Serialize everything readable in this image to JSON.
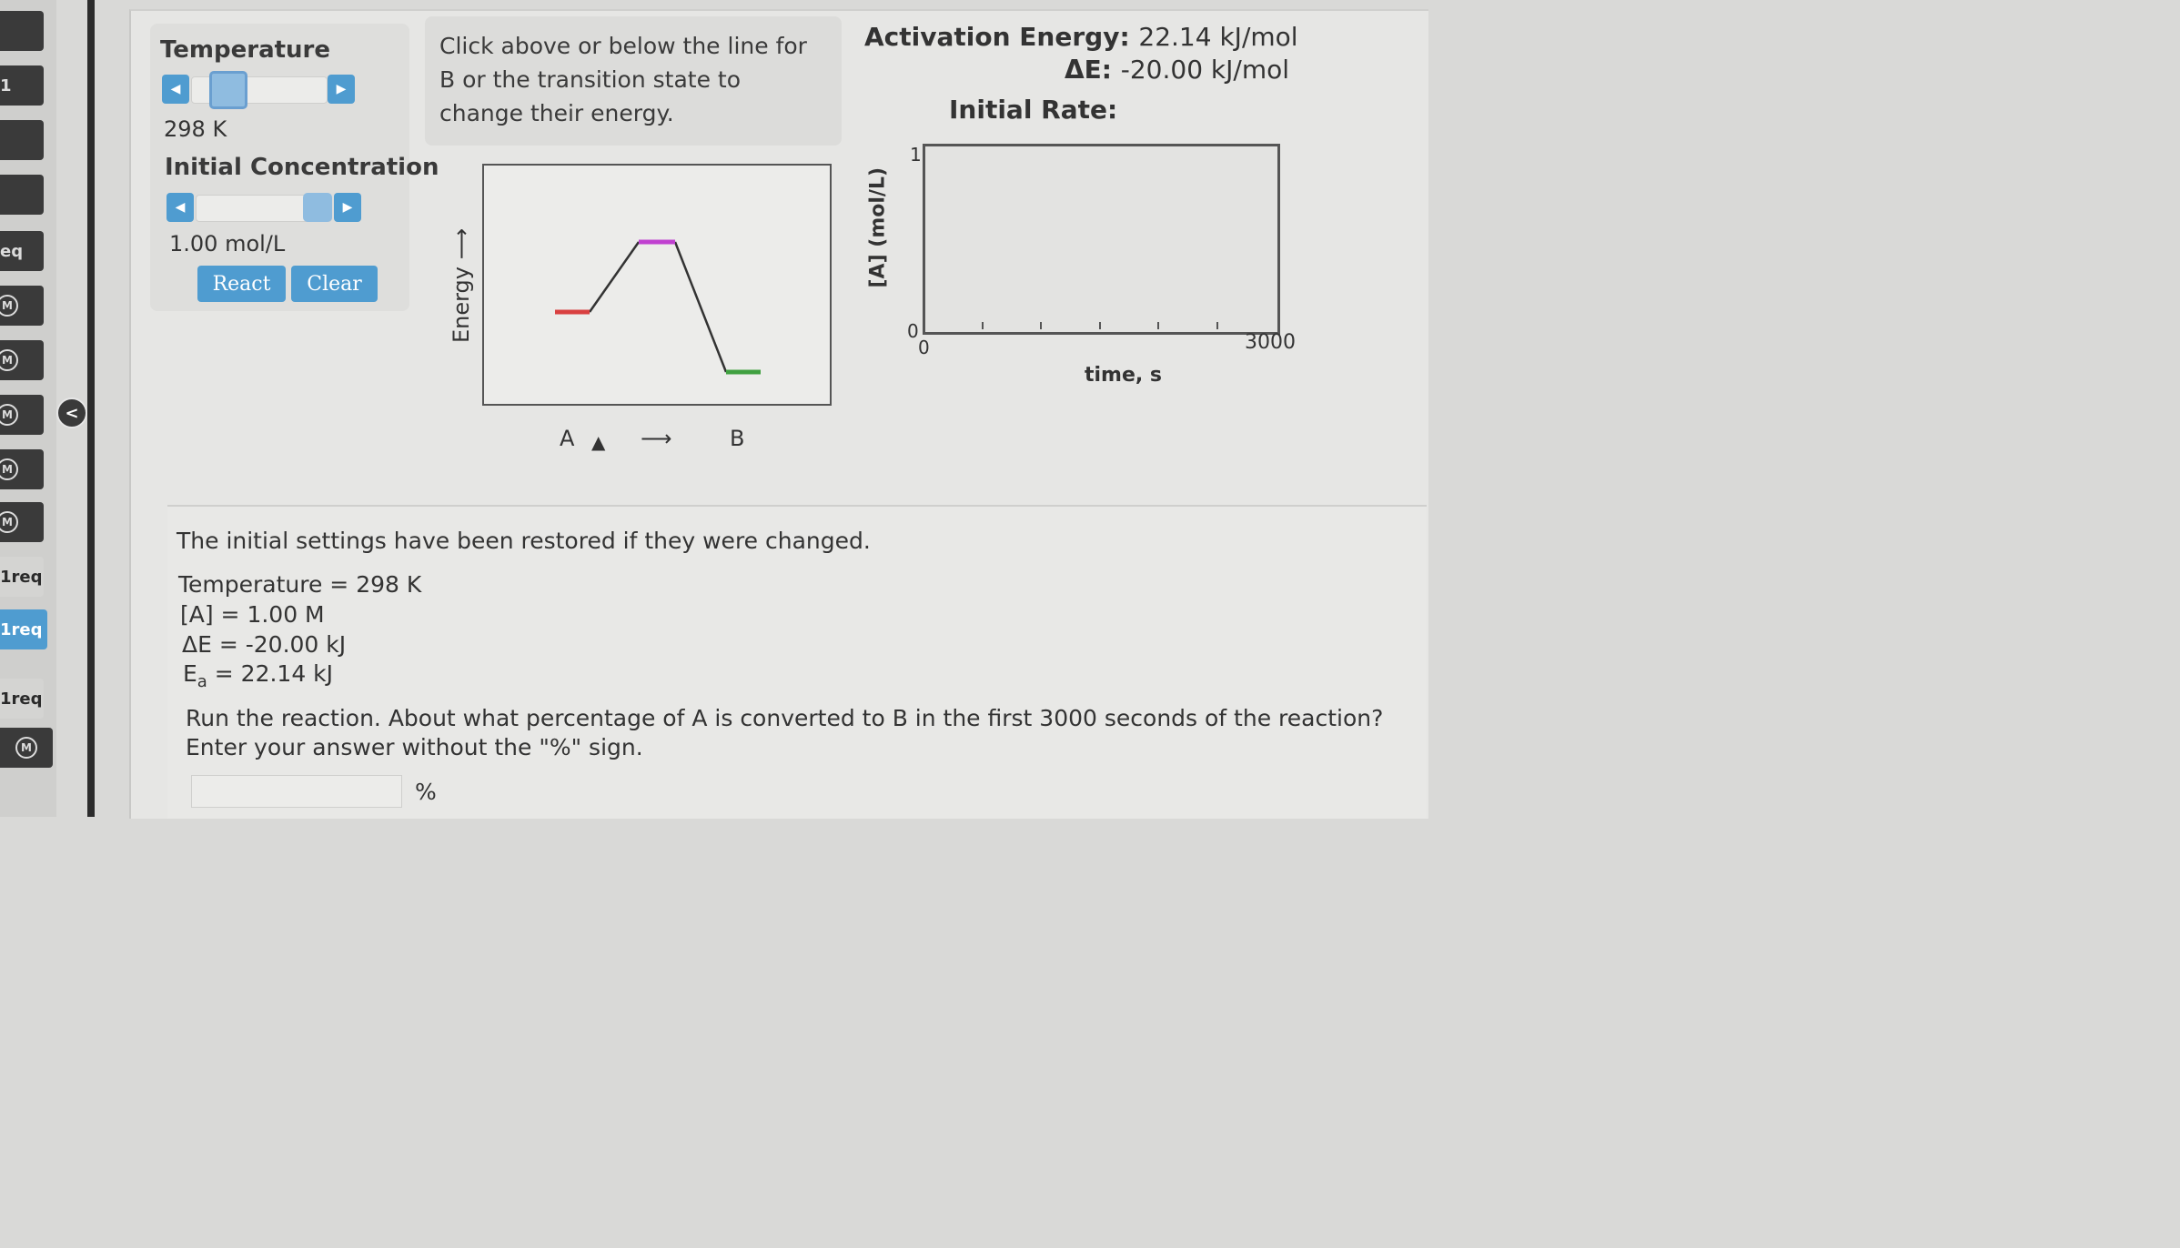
{
  "sidebar": {
    "items": [
      {
        "label": "",
        "style": "dark"
      },
      {
        "label": "1",
        "style": "dark"
      },
      {
        "label": "",
        "style": "dark"
      },
      {
        "label": "",
        "style": "dark"
      },
      {
        "label": "eq",
        "style": "dark"
      },
      {
        "label": "M",
        "style": "dark-m"
      },
      {
        "label": "M",
        "style": "dark-m"
      },
      {
        "label": "M",
        "style": "dark-m"
      },
      {
        "label": "M",
        "style": "dark-m"
      },
      {
        "label": "M",
        "style": "dark-m"
      },
      {
        "label": "1req",
        "style": "light"
      },
      {
        "label": "1req",
        "style": "active"
      },
      {
        "label": "1req",
        "style": "light"
      },
      {
        "label": "M",
        "style": "dark-m"
      }
    ],
    "collapse_icon": "chevron-left-icon"
  },
  "controls": {
    "temperature_label": "Temperature",
    "temperature_value": "298 K",
    "temperature_slider_fraction": 0.0,
    "concentration_label": "Initial Concentration",
    "concentration_value": "1.00 mol/L",
    "concentration_slider_fraction": 1.0,
    "react_button": "React",
    "clear_button": "Clear"
  },
  "hint": {
    "text": "Click above or below the line for B or the transition state to change their energy."
  },
  "energy_diagram": {
    "ylabel": "Energy ⟶",
    "reactant_label": "A",
    "arrow_label": "⟶",
    "product_label": "B",
    "colors": {
      "reactant": "#d94040",
      "transition": "#c040d0",
      "product": "#40a040",
      "line": "#333333"
    }
  },
  "summary": {
    "activation_label": "Activation Energy:",
    "activation_value": "22.14 kJ/mol",
    "delta_e_label": "ΔE:",
    "delta_e_value": "-20.00 kJ/mol",
    "initial_rate_label": "Initial Rate:"
  },
  "rate_plot": {
    "ylabel": "[A] (mol/L)",
    "xlabel": "time, s",
    "y_max_label": "1",
    "y_min_label": "0",
    "x_min_label": "0",
    "x_max_label": "3000",
    "x_tick_count": 6
  },
  "message": {
    "restored": "The initial settings have been restored if they were changed.",
    "temperature_line": "Temperature = 298 K",
    "conc_line": "[A] = 1.00 M",
    "delta_e_line": "ΔE = -20.00 kJ",
    "ea_prefix": "E",
    "ea_sub": "a",
    "ea_rest": " = 22.14 kJ",
    "question": "Run the reaction. About what percentage of A is converted to B in the first 3000 seconds of the reaction? Enter your answer without the \"%\" sign.",
    "answer_value": "",
    "unit": "%"
  }
}
